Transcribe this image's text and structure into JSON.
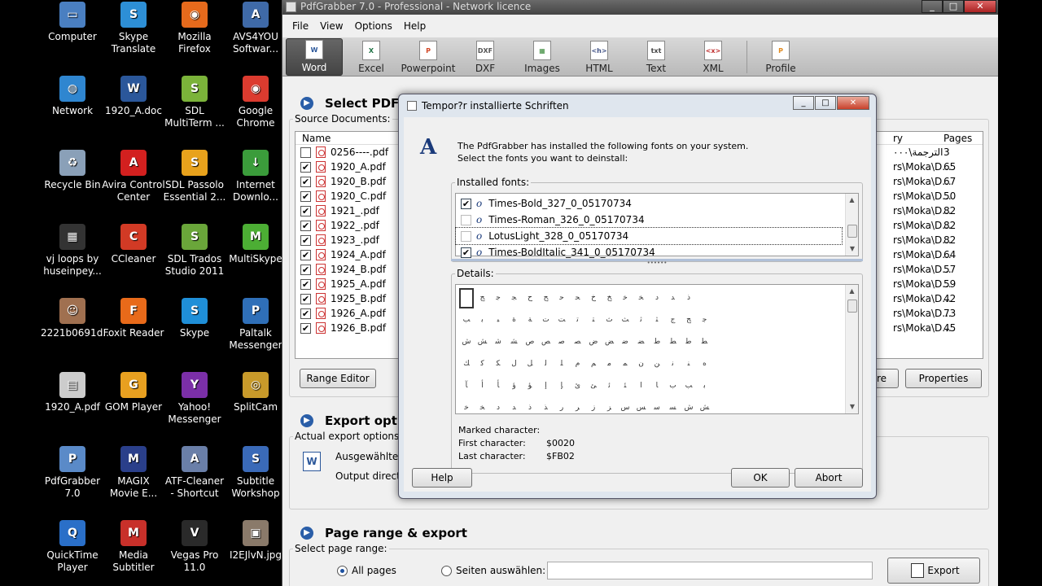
{
  "desktop": {
    "icons": [
      {
        "label": "Computer",
        "color": "#4a7fc1",
        "glyph": "▭",
        "col": 0,
        "row": 0
      },
      {
        "label": "Skype\nTranslate",
        "color": "#2d8fd6",
        "glyph": "S",
        "col": 1,
        "row": 0
      },
      {
        "label": "Mozilla\nFirefox",
        "color": "#e66a1c",
        "glyph": "◉",
        "col": 2,
        "row": 0
      },
      {
        "label": "AVS4YOU\nSoftwar...",
        "color": "#3f6aa8",
        "glyph": "A",
        "col": 3,
        "row": 0
      },
      {
        "label": "Network",
        "color": "#2f86d0",
        "glyph": "◍",
        "col": 0,
        "row": 1
      },
      {
        "label": "1920_A.doc",
        "color": "#2b579a",
        "glyph": "W",
        "col": 1,
        "row": 1
      },
      {
        "label": "SDL\nMultiTerm ...",
        "color": "#7bb33a",
        "glyph": "S",
        "col": 2,
        "row": 1
      },
      {
        "label": "Google\nChrome",
        "color": "#dc3b2f",
        "glyph": "◉",
        "col": 3,
        "row": 1
      },
      {
        "label": "Recycle Bin",
        "color": "#8aa0b8",
        "glyph": "♻",
        "col": 0,
        "row": 2
      },
      {
        "label": "Avira Control\nCenter",
        "color": "#d3201f",
        "glyph": "A",
        "col": 1,
        "row": 2
      },
      {
        "label": "SDL Passolo\nEssential 2...",
        "color": "#e8a21c",
        "glyph": "S",
        "col": 2,
        "row": 2
      },
      {
        "label": "Internet\nDownlo...",
        "color": "#3b9c3b",
        "glyph": "↓",
        "col": 3,
        "row": 2
      },
      {
        "label": "vj loops by\nhuseinpey...",
        "color": "#333333",
        "glyph": "▦",
        "col": 0,
        "row": 3
      },
      {
        "label": "CCleaner",
        "color": "#d23a25",
        "glyph": "C",
        "col": 1,
        "row": 3
      },
      {
        "label": "SDL Trados\nStudio 2011",
        "color": "#6aa63a",
        "glyph": "S",
        "col": 2,
        "row": 3
      },
      {
        "label": "MultiSkype",
        "color": "#4cae34",
        "glyph": "M",
        "col": 3,
        "row": 3
      },
      {
        "label": "2221b0691d...",
        "color": "#a07050",
        "glyph": "☺",
        "col": 0,
        "row": 4
      },
      {
        "label": "Foxit Reader",
        "color": "#e86a1a",
        "glyph": "F",
        "col": 1,
        "row": 4
      },
      {
        "label": "Skype",
        "color": "#1f8fd8",
        "glyph": "S",
        "col": 2,
        "row": 4
      },
      {
        "label": "Paltalk\nMessenger",
        "color": "#2f6fb8",
        "glyph": "P",
        "col": 3,
        "row": 4
      },
      {
        "label": "1920_A.pdf",
        "color": "#cccccc",
        "glyph": "▤",
        "col": 0,
        "row": 5
      },
      {
        "label": "GOM Player",
        "color": "#e8a020",
        "glyph": "G",
        "col": 1,
        "row": 5
      },
      {
        "label": "Yahoo!\nMessenger",
        "color": "#7b2fa8",
        "glyph": "Y",
        "col": 2,
        "row": 5
      },
      {
        "label": "SplitCam",
        "color": "#c89a2a",
        "glyph": "◎",
        "col": 3,
        "row": 5
      },
      {
        "label": "PdfGrabber\n7.0",
        "color": "#5a8ac8",
        "glyph": "P",
        "col": 0,
        "row": 6
      },
      {
        "label": "MAGIX\nMovie E...",
        "color": "#2a3f8a",
        "glyph": "M",
        "col": 1,
        "row": 6
      },
      {
        "label": "ATF-Cleaner\n- Shortcut",
        "color": "#6a7fa8",
        "glyph": "A",
        "col": 2,
        "row": 6
      },
      {
        "label": "Subtitle\nWorkshop",
        "color": "#3a6ab8",
        "glyph": "S",
        "col": 3,
        "row": 6
      },
      {
        "label": "QuickTime\nPlayer",
        "color": "#2a6fc8",
        "glyph": "Q",
        "col": 0,
        "row": 7
      },
      {
        "label": "Media\nSubtitler",
        "color": "#c8302a",
        "glyph": "M",
        "col": 1,
        "row": 7
      },
      {
        "label": "Vegas Pro\n11.0",
        "color": "#2a2a2a",
        "glyph": "V",
        "col": 2,
        "row": 7
      },
      {
        "label": "I2EJlvN.jpg",
        "color": "#8a7a6a",
        "glyph": "▣",
        "col": 3,
        "row": 7
      }
    ]
  },
  "app": {
    "title": "PdfGrabber 7.0 - Professional - Network licence",
    "menu": [
      "File",
      "View",
      "Options",
      "Help"
    ],
    "toolbar": [
      {
        "label": "Word",
        "glyph": "W",
        "color": "#2b579a",
        "active": true
      },
      {
        "label": "Excel",
        "glyph": "X",
        "color": "#217346"
      },
      {
        "label": "Powerpoint",
        "glyph": "P",
        "color": "#d24726"
      },
      {
        "label": "DXF",
        "glyph": "DXF",
        "color": "#555555"
      },
      {
        "label": "Images",
        "glyph": "▦",
        "color": "#3a8a3a"
      },
      {
        "label": "HTML",
        "glyph": "<h>",
        "color": "#445588"
      },
      {
        "label": "Text",
        "glyph": "txt",
        "color": "#444444"
      },
      {
        "label": "XML",
        "glyph": "<x>",
        "color": "#c03030"
      },
      {
        "label": "Profile",
        "glyph": "P",
        "color": "#e08a20"
      }
    ],
    "select_pdf_heading": "Select PDF fi",
    "source_documents_label": "Source Documents:",
    "col_name": "Name",
    "col_directory": "ry",
    "col_pages": "Pages",
    "files": [
      {
        "name": "0256----.pdf",
        "checked": false,
        "dir": "الترجمة\\٠٠٠",
        "pages": "3"
      },
      {
        "name": "1920_A.pdf",
        "checked": true,
        "dir": "rs\\Moka\\D...",
        "pages": "65"
      },
      {
        "name": "1920_B.pdf",
        "checked": true,
        "dir": "rs\\Moka\\D...",
        "pages": "67"
      },
      {
        "name": "1920_C.pdf",
        "checked": true,
        "dir": "rs\\Moka\\D...",
        "pages": "50"
      },
      {
        "name": "1921_.pdf",
        "checked": true,
        "dir": "rs\\Moka\\D...",
        "pages": "82"
      },
      {
        "name": "1922_.pdf",
        "checked": true,
        "dir": "rs\\Moka\\D...",
        "pages": "82"
      },
      {
        "name": "1923_.pdf",
        "checked": true,
        "dir": "rs\\Moka\\D...",
        "pages": "82"
      },
      {
        "name": "1924_A.pdf",
        "checked": true,
        "dir": "rs\\Moka\\D...",
        "pages": "64"
      },
      {
        "name": "1924_B.pdf",
        "checked": true,
        "dir": "rs\\Moka\\D...",
        "pages": "57"
      },
      {
        "name": "1925_A.pdf",
        "checked": true,
        "dir": "rs\\Moka\\D...",
        "pages": "59"
      },
      {
        "name": "1925_B.pdf",
        "checked": true,
        "dir": "rs\\Moka\\D...",
        "pages": "42"
      },
      {
        "name": "1926_A.pdf",
        "checked": true,
        "dir": "rs\\Moka\\D...",
        "pages": "73"
      },
      {
        "name": "1926_B.pdf",
        "checked": true,
        "dir": "rs\\Moka\\D...",
        "pages": "45"
      }
    ],
    "range_editor_button": "Range Editor",
    "remove_button_fragment": "re",
    "properties_button": "Properties",
    "export_options_heading": "Export optio",
    "actual_export_options_label": "Actual export options:",
    "ausgewahltes": "Ausgewähltes",
    "output_directory": "Output directo",
    "page_range_heading": "Page range & export",
    "select_page_range_label": "Select page range:",
    "all_pages": "All pages",
    "seiten_auswahlen": "Seiten auswählen:",
    "export_button": "Export"
  },
  "dialog": {
    "title": "Tempor?r installierte Schriften",
    "intro_line1": "The PdfGrabber has installed the following fonts on your system.",
    "intro_line2": "Select the fonts you want to deinstall:",
    "installed_fonts_label": "Installed fonts:",
    "fonts": [
      {
        "name": "Times-Bold_327_0_05170734",
        "checked": true
      },
      {
        "name": "Times-Roman_326_0_05170734",
        "checked": false
      },
      {
        "name": "LotusLight_328_0_05170734",
        "checked": false,
        "focused": true
      },
      {
        "name": "Times-BoldItalic_341_0_05170734",
        "checked": true
      }
    ],
    "details_label": "Details:",
    "glyph_rows": [
      [
        "",
        "ﺞ",
        "ﺟ",
        "ﺠ",
        "ﺡ",
        "ﺢ",
        "ﺣ",
        "ﺤ",
        "ﺥ",
        "ﺦ",
        "ﺧ",
        "ﺨ",
        "ﺩ",
        "ﺪ",
        "ﺫ",
        "",
        "ﺭ",
        "ﺮ",
        "ﺯ",
        "ﺰ",
        "ﺱ",
        "ﺲ",
        "ﺳ",
        "ﺴ",
        "ﺵ",
        "ﺶ",
        "ﺷ",
        "ﺸ",
        "ﺹ",
        "ﺺ",
        "ﺻ",
        "ﺼ",
        "ﺽ",
        "ﺾ",
        "ﺿ",
        "ﻀ",
        "ﻁ"
      ],
      [
        "ﺐ",
        "ﺑ",
        "ﺒ",
        "ﺓ",
        "ﺔ",
        "ﺕ",
        "ﺖ",
        "ﺗ",
        "ﺘ",
        "ﺙ",
        "ﺚ",
        "ﺛ",
        "ﺜ",
        "ﺝ",
        "ﺞ",
        "ﺟ",
        "ﺠ",
        "ﺡ",
        "ﺢ",
        "ﺣ",
        "ﺤ",
        "ﺥ",
        "ﺦ",
        "ﺧ",
        "ﺨ",
        "ﺩ",
        "ﺪ",
        "ﺫ",
        "ﺬ",
        "ﺭ",
        "ﺮ",
        "ﺯ",
        "ﺰ",
        "ﺱ",
        "ﺲ",
        "ﺳ",
        "ﺴ"
      ],
      [
        "ﺵ",
        "ﺶ",
        "ﺷ",
        "ﺸ",
        "ﺹ",
        "ﺺ",
        "ﺻ",
        "ﺼ",
        "ﺽ",
        "ﺾ",
        "ﺿ",
        "ﻀ",
        "ﻁ",
        "ﻂ",
        "ﻃ",
        "ﻄ",
        "ﻅ",
        "ﻆ",
        "ﻇ",
        "ﻈ",
        "ﻉ",
        "ﻊ",
        "ﻋ",
        "ﻌ",
        "ﻍ",
        "ﻎ",
        "ﻏ",
        "ﻐ",
        "ﻑ",
        "ﻒ",
        "ﻓ",
        "ﻔ",
        "ﻕ",
        "ﻖ",
        "ﻗ",
        "ﻘ",
        "ﻙ"
      ],
      [
        "ﻚ",
        "ﻛ",
        "ﻜ",
        "ﻝ",
        "ﻞ",
        "ﻟ",
        "ﻠ",
        "ﻡ",
        "ﻢ",
        "ﻣ",
        "ﻤ",
        "ﻥ",
        "ﻦ",
        "ﻧ",
        "ﻨ",
        "ﻩ",
        "ﻪ",
        "ﻫ",
        "ﻬ",
        "ﻭ",
        "ﻮ",
        "ﻯ",
        "ﻰ",
        "ﻱ",
        "ﻲ",
        "ﻳ",
        "ﻴ",
        "ﻵ",
        "ﻶ",
        "ﻷ",
        "ﻸ",
        "ﻹ",
        "ﻺ",
        "ﻻ",
        "ﻼ",
        "ﺀ",
        "ﺁ"
      ],
      [
        "ﺂ",
        "ﺃ",
        "ﺄ",
        "ﺅ",
        "ﺆ",
        "ﺇ",
        "ﺈ",
        "ﺉ",
        "ﺊ",
        "ﺋ",
        "ﺌ",
        "ﺍ",
        "ﺎ",
        "ﺏ",
        "ﺐ",
        "ﺑ",
        "ﺒ",
        "ﺓ",
        "ﺔ",
        "ﺕ",
        "ﺖ",
        "ﺗ",
        "ﺘ",
        "ﺙ",
        "ﺚ",
        "ﺛ",
        "ﺜ",
        "ﺝ",
        "ﺞ",
        "ﺟ",
        "ﺠ",
        "ﺡ",
        "ﺢ",
        "ﺣ",
        "ﺤ",
        "ﺥ",
        "ﺦ"
      ],
      [
        "ﺧ",
        "ﺨ",
        "ﺩ",
        "ﺪ",
        "ﺫ",
        "ﺬ",
        "ﺭ",
        "ﺮ",
        "ﺯ",
        "ﺰ",
        "ﺱ",
        "ﺲ",
        "ﺳ",
        "ﺴ",
        "ﺵ",
        "ﺶ",
        "ﺷ",
        "ﺸ",
        "ﺹ",
        "ﺺ",
        "ﺻ",
        "ﺼ",
        "ﺽ",
        "ﺾ",
        "ﺿ",
        "ﻀ",
        "ﻁ",
        "ﻂ",
        "ﻃ",
        "ﻄ",
        "ﻅ",
        "ﻆ",
        "ﻇ",
        "ﻈ",
        "ﻉ",
        "ﻊ",
        "ﻋ"
      ]
    ],
    "marked_character_label": "Marked character:",
    "first_character_label": "First character:",
    "first_character_value": "$0020",
    "last_character_label": "Last character:",
    "last_character_value": "$FB02",
    "help_button": "Help",
    "ok_button": "OK",
    "abort_button": "Abort"
  }
}
